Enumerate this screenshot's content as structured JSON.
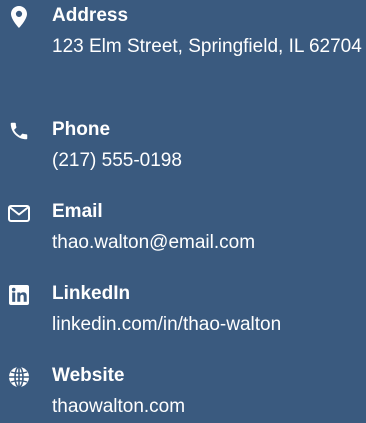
{
  "contact": {
    "address": {
      "label": "Address",
      "value": "123 Elm Street, Springfield, IL 62704",
      "icon": "map-pin-icon"
    },
    "phone": {
      "label": "Phone",
      "value": "(217) 555-0198",
      "icon": "phone-icon"
    },
    "email": {
      "label": "Email",
      "value": "thao.walton@email.com",
      "icon": "envelope-icon"
    },
    "linkedin": {
      "label": "LinkedIn",
      "value": "linkedin.com/in/thao-walton",
      "icon": "linkedin-icon"
    },
    "website": {
      "label": "Website",
      "value": "thaowalton.com",
      "icon": "globe-icon"
    }
  },
  "colors": {
    "background": "#3a5a7f",
    "text": "#ffffff"
  }
}
